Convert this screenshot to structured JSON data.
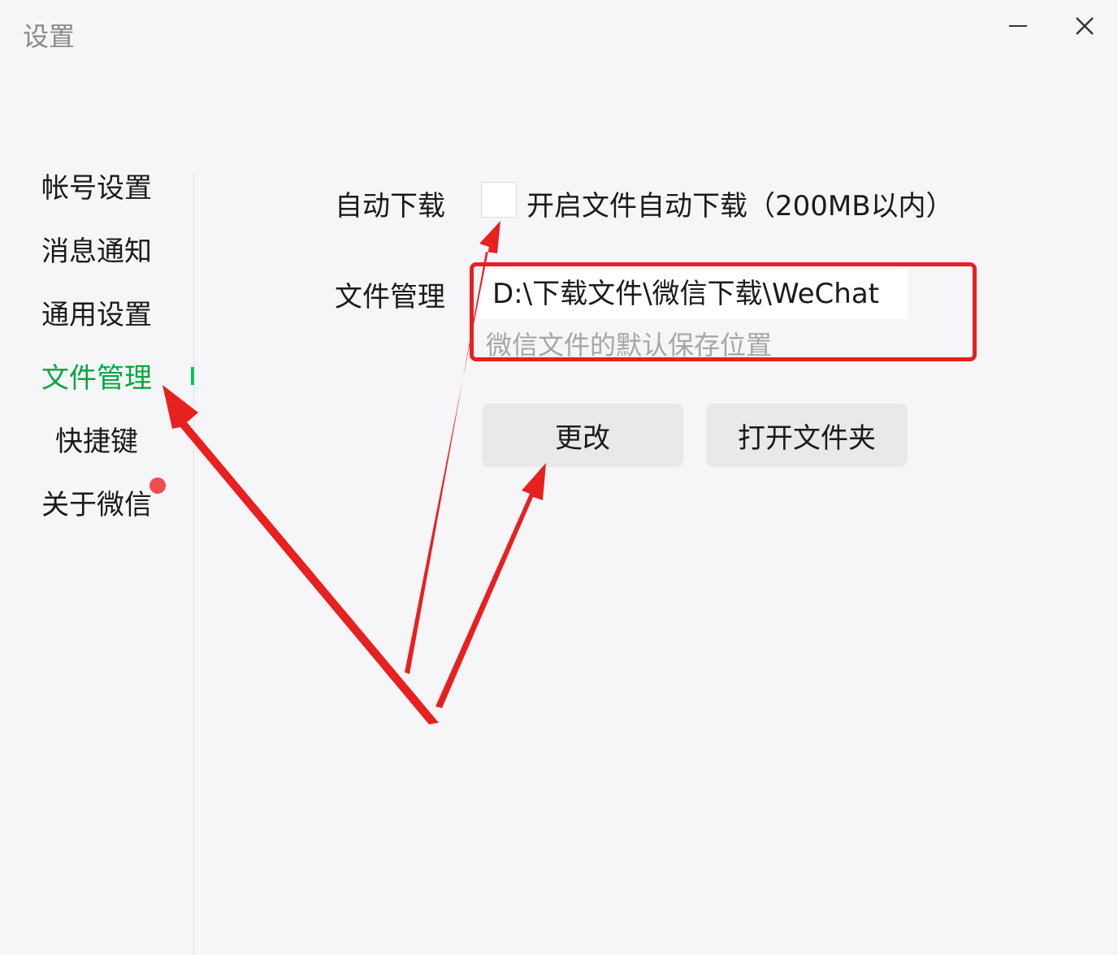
{
  "window": {
    "title": "设置",
    "minimize_glyph": "—",
    "close_glyph": "✕"
  },
  "sidebar": {
    "items": [
      {
        "label": "帐号设置"
      },
      {
        "label": "消息通知"
      },
      {
        "label": "通用设置"
      },
      {
        "label": "文件管理",
        "active": true
      },
      {
        "label": "快捷键"
      },
      {
        "label": "关于微信",
        "has_notification_dot": true
      }
    ]
  },
  "auto_download": {
    "label": "自动下载",
    "checked": false,
    "checkbox_label": "开启文件自动下载（200MB以内）"
  },
  "file_manage": {
    "label": "文件管理",
    "path": "D:\\下载文件\\微信下载\\WeChat",
    "hint": "微信文件的默认保存位置",
    "change_button": "更改",
    "open_folder_button": "打开文件夹"
  },
  "colors": {
    "accent_green": "#07c160",
    "annotation_red": "#e8201f",
    "badge_red": "#f24c52"
  }
}
